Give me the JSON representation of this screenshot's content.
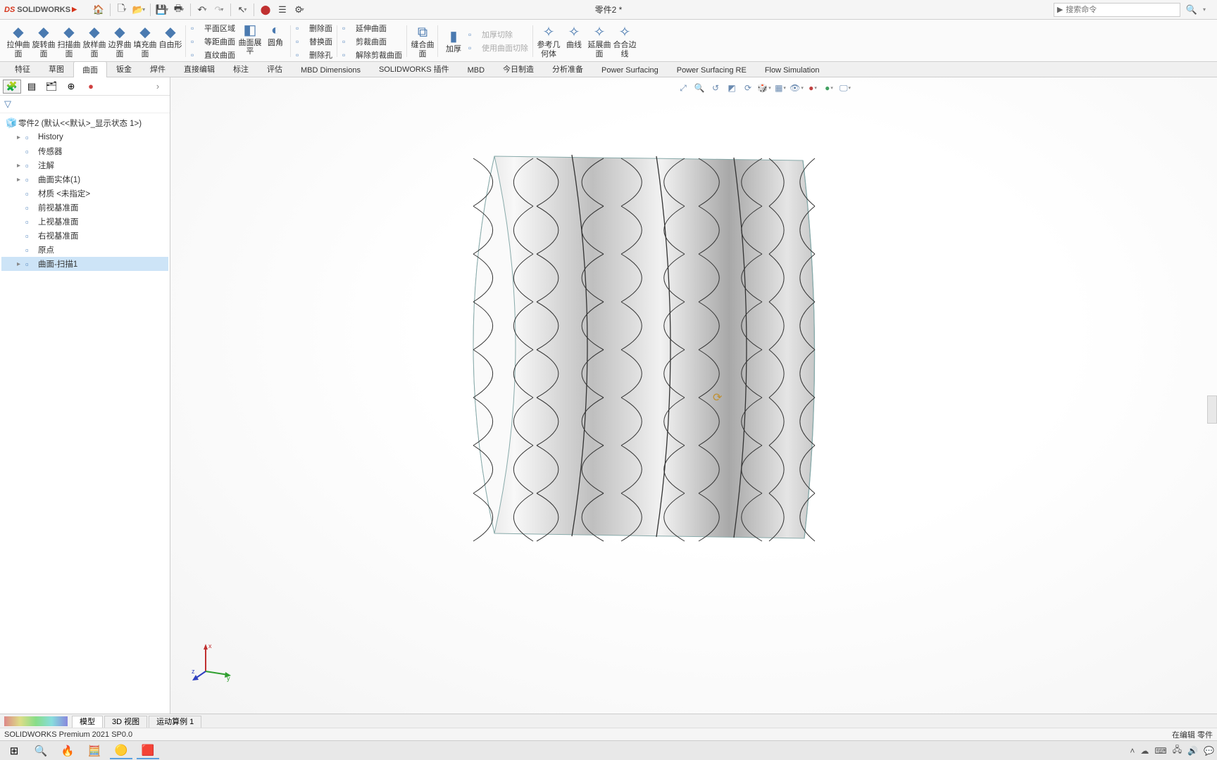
{
  "app": {
    "logo_ds": "DS",
    "logo_name": "SOLIDWORKS",
    "doc_title": "零件2 *"
  },
  "search": {
    "placeholder": "搜索命令"
  },
  "ribbon": {
    "big": [
      {
        "label": "拉伸曲\n面"
      },
      {
        "label": "旋转曲\n面"
      },
      {
        "label": "扫描曲\n面"
      },
      {
        "label": "放样曲\n面"
      },
      {
        "label": "边界曲\n面"
      },
      {
        "label": "填充曲\n面"
      },
      {
        "label": "自由形"
      }
    ],
    "g2_big1": "曲面展\n平",
    "g2_big2": "圆角",
    "g2_rows": [
      "平面区域",
      "等距曲面",
      "直纹曲面"
    ],
    "g3_rows": [
      "删除面",
      "替换面",
      "删除孔"
    ],
    "g4_rows": [
      "延伸曲面",
      "剪裁曲面",
      "解除剪裁曲面"
    ],
    "g5_big": "缝合曲\n面",
    "g6_big": "加厚",
    "g6_rows": [
      "加厚切除",
      "使用曲面切除"
    ],
    "g7": [
      {
        "l": "参考几\n何体"
      },
      {
        "l": "曲线"
      },
      {
        "l": "延展曲\n面"
      },
      {
        "l": "合合边\n线"
      }
    ]
  },
  "tabs": [
    "特征",
    "草图",
    "曲面",
    "钣金",
    "焊件",
    "直接编辑",
    "标注",
    "评估",
    "MBD Dimensions",
    "SOLIDWORKS 插件",
    "MBD",
    "今日制造",
    "分析准备",
    "Power Surfacing",
    "Power Surfacing RE",
    "Flow Simulation"
  ],
  "active_tab": "曲面",
  "tree": {
    "root": "零件2  (默认<<默认>_显示状态 1>)",
    "items": [
      {
        "l": "History",
        "child": true,
        "exp": "▸"
      },
      {
        "l": "传感器",
        "child": true
      },
      {
        "l": "注解",
        "child": true,
        "exp": "▸"
      },
      {
        "l": "曲面实体(1)",
        "child": true,
        "exp": "▸"
      },
      {
        "l": "材质 <未指定>",
        "child": true
      },
      {
        "l": "前视基准面",
        "child": true
      },
      {
        "l": "上视基准面",
        "child": true
      },
      {
        "l": "右视基准面",
        "child": true
      },
      {
        "l": "原点",
        "child": true
      },
      {
        "l": "曲面-扫描1",
        "child": true,
        "exp": "▸",
        "sel": true
      }
    ]
  },
  "btabs": [
    "模型",
    "3D 视图",
    "运动算例 1"
  ],
  "status": {
    "left": "SOLIDWORKS Premium 2021 SP0.0",
    "right": "在编辑 零件"
  },
  "triad": {
    "x": "x",
    "y": "y",
    "z": "z"
  }
}
